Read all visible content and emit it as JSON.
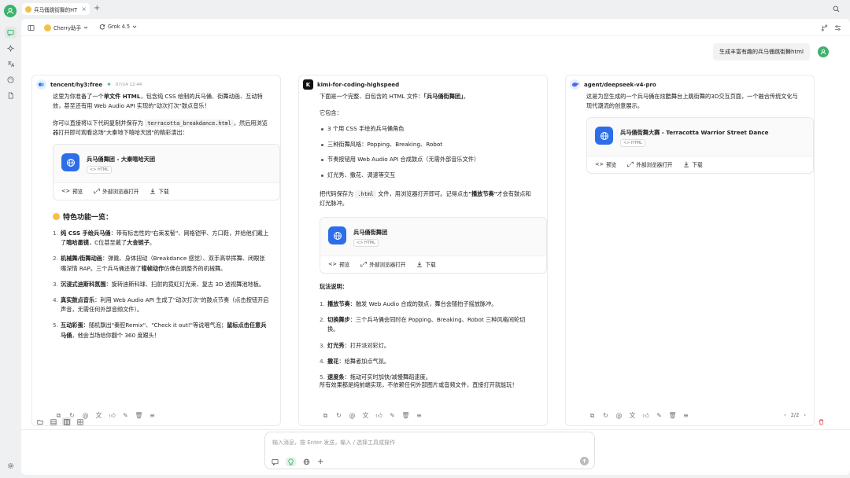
{
  "app": {
    "accent": "#3bb36b",
    "link_blue": "#2d6ee8"
  },
  "tab": {
    "title": "兵马俑跳街舞的HT",
    "close": "×",
    "new": "+"
  },
  "topbar": {
    "assistant": "Cherry助手",
    "model": "Grok 4.5"
  },
  "user_message": "生成丰富有趣的兵马俑跳街舞html",
  "artifact_badge": "<> HTML",
  "actions": {
    "preview": "预览",
    "open_external": "外部浏览器打开",
    "download": "下载"
  },
  "col1": {
    "model": "tencent/hy3:free",
    "time": "07/14 12:44",
    "p1": "这里为你准备了一个",
    "p1_bold": "单文件 HTML",
    "p1b": "，包含纯 CSS 绘制的兵马俑、街舞动画、互动特效，甚至还有用 Web Audio API 实现的\"动次打次\"鼓点音乐！",
    "p2a": "你可以直接将以下代码复制并保存为",
    "p2_code": "terracotta_breakdance.html",
    "p2b": "，然后用浏览器打开即可观看这场\"大秦地下嘻哈天团\"的精彩演出：",
    "artifact_title": "兵马俑舞团 - 大秦嘻哈天团",
    "features_title": "特色功能一览：",
    "features": [
      {
        "n": "1.",
        "b": "纯 CSS 手绘兵马俑",
        "t": "：带有标志性的\"右束发髻\"、网格铠甲、方口鞋，并给他们戴上了",
        "b2": "嘻哈墨镜",
        "t2": "，C位甚至戴了",
        "b3": "大金链子",
        "t3": "。"
      },
      {
        "n": "2.",
        "b": "机械舞/街舞动画",
        "t": "：弹跳、身体扭动（Breakdance 感觉）、双手高举挥舞、闭眼张嘴深情 RAP。三个兵马俑还做了",
        "b2": "错帧动作",
        "t2": "仿佛在跳整齐的机械舞。",
        "b3": "",
        "t3": ""
      },
      {
        "n": "3.",
        "b": "沉浸式迪斯科氛围",
        "t": "：旋转迪斯科球、扫射的霓虹灯光束、复古 3D 透视舞池地板。",
        "b2": "",
        "t2": "",
        "b3": "",
        "t3": ""
      },
      {
        "n": "4.",
        "b": "真实鼓点音乐",
        "t": "：利用 Web Audio API 生成了\"动次打次\"的鼓点节奏（点击按钮开启声音，无需任何外部音频文件）。",
        "b2": "",
        "t2": "",
        "b3": "",
        "t3": ""
      },
      {
        "n": "5.",
        "b": "互动彩蛋",
        "t": "：随机飘出\"秦腔Remix\"、\"Check it out!\"等说唱气泡；",
        "b2": "鼠标点击任意兵马俑",
        "t2": "，他会当场给你翻个 360 度跟头！",
        "b3": "",
        "t3": ""
      }
    ]
  },
  "col2": {
    "model": "kimi-for-coding-highspeed",
    "p1a": "下面是一个完整、自包含的 HTML 文件：",
    "p1_bold": "「兵马俑街舞团」",
    "p1b": "。",
    "contains": "它包含：",
    "bullets": [
      "3 个用 CSS 手绘的兵马俑角色",
      "三种街舞风格：Popping、Breaking、Robot",
      "节奏按钮用 Web Audio API 合成鼓点（无需外部音乐文件）",
      "灯光秀、撒花、调速等交互"
    ],
    "p3a": "把代码保存为",
    "p3_code": ".html",
    "p3b": "文件，用浏览器打开即可。记得点击",
    "p3_bold": "\"播放节奏\"",
    "p3c": "才会有鼓点和灯光脉冲。",
    "artifact_title": "兵马俑街舞团",
    "play_title": "玩法说明：",
    "plays": [
      {
        "n": "1.",
        "b": "播放节奏",
        "t": "：触发 Web Audio 合成的鼓点，舞台会随拍子摇放脉冲。"
      },
      {
        "n": "2.",
        "b": "切换舞步",
        "t": "：三个兵马俑会同时在 Popping、Breaking、Robot 三种风格间轮切换。"
      },
      {
        "n": "3.",
        "b": "灯光秀",
        "t": "：打开派对彩灯。"
      },
      {
        "n": "4.",
        "b": "撒花",
        "t": "：给舞者加点气氛。"
      },
      {
        "n": "5.",
        "b": "速度条",
        "t": "：拖动可实时加快/减慢舞蹈速度。"
      }
    ],
    "closing": "所有效果都是纯前端实现，不依赖任何外部图片或音频文件，直接打开就能玩！"
  },
  "col3": {
    "model": "agent/deepseek-v4-pro",
    "p1": "这是为您生成的一个兵马俑在炫酷舞台上跳街舞的3D交互页面，一个融合传统文化与现代潮流的创意展示。",
    "artifact_title": "兵马俑街舞大赛 - Terracotta Warrior Street Dance",
    "pager": "2/2"
  },
  "input": {
    "placeholder": "输入消息，按 Enter 发送，输入 / 选择工具或操作"
  }
}
